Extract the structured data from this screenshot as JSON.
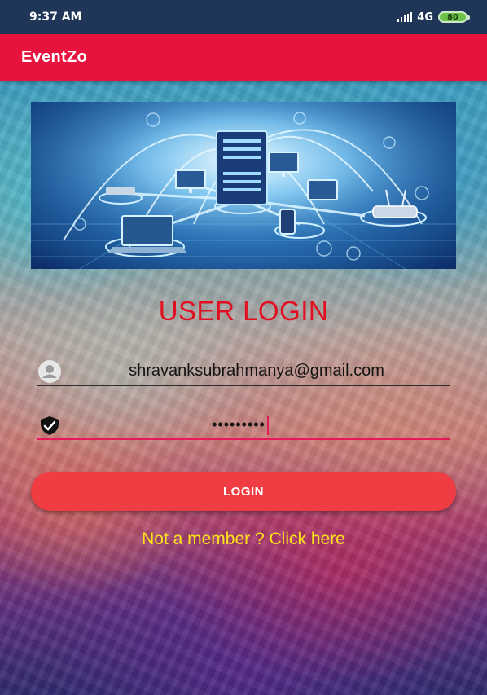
{
  "status_bar": {
    "time": "9:37 AM",
    "network": "4G",
    "battery": "80",
    "icons": [
      "signal-icon",
      "battery-icon"
    ]
  },
  "app_bar": {
    "title": "EventZo"
  },
  "banner": {
    "icon": "network-illustration"
  },
  "login": {
    "heading": "USER LOGIN",
    "email_value": "shravanksubrahmanya@gmail.com",
    "email_icon": "user-icon",
    "password_value": "•••••••••",
    "password_icon": "shield-check-icon",
    "button_label": "LOGIN",
    "register_link": "Not a member ? Click here"
  },
  "colors": {
    "app_bar": "#e8123e",
    "title": "#e01020",
    "button": "#ef3d43",
    "link": "#ffe51a",
    "password_underline": "#e8195a"
  }
}
